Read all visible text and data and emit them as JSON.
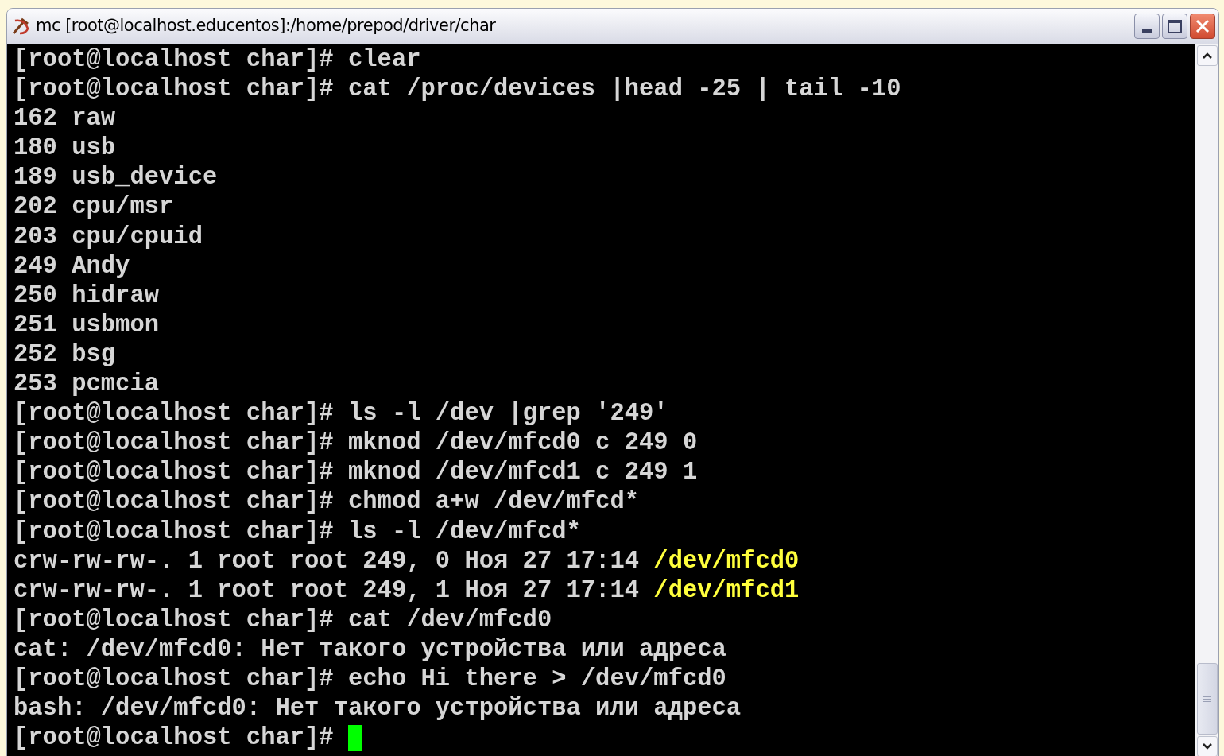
{
  "window": {
    "title": "mc [root@localhost.educentos]:/home/prepod/driver/char"
  },
  "terminal": {
    "lines": [
      {
        "text": "[root@localhost char]# clear"
      },
      {
        "text": "[root@localhost char]# cat /proc/devices |head -25 | tail -10"
      },
      {
        "text": "162 raw"
      },
      {
        "text": "180 usb"
      },
      {
        "text": "189 usb_device"
      },
      {
        "text": "202 cpu/msr"
      },
      {
        "text": "203 cpu/cpuid"
      },
      {
        "text": "249 Andy"
      },
      {
        "text": "250 hidraw"
      },
      {
        "text": "251 usbmon"
      },
      {
        "text": "252 bsg"
      },
      {
        "text": "253 pcmcia"
      },
      {
        "text": "[root@localhost char]# ls -l /dev |grep '249'"
      },
      {
        "text": "[root@localhost char]# mknod /dev/mfcd0 c 249 0"
      },
      {
        "text": "[root@localhost char]# mknod /dev/mfcd1 c 249 1"
      },
      {
        "text": "[root@localhost char]# chmod a+w /dev/mfcd*"
      },
      {
        "text": "[root@localhost char]# ls -l /dev/mfcd*"
      },
      {
        "text": "crw-rw-rw-. 1 root root 249, 0 Ноя 27 17:14",
        "file": "/dev/mfcd0"
      },
      {
        "text": "crw-rw-rw-. 1 root root 249, 1 Ноя 27 17:14",
        "file": "/dev/mfcd1"
      },
      {
        "text": "[root@localhost char]# cat /dev/mfcd0"
      },
      {
        "text": "cat: /dev/mfcd0: Нет такого устройства или адреса"
      },
      {
        "text": "[root@localhost char]# echo Hi there > /dev/mfcd0"
      },
      {
        "text": "bash: /dev/mfcd0: Нет такого устройства или адреса"
      },
      {
        "text": "[root@localhost char]#",
        "cursor": true
      }
    ]
  }
}
